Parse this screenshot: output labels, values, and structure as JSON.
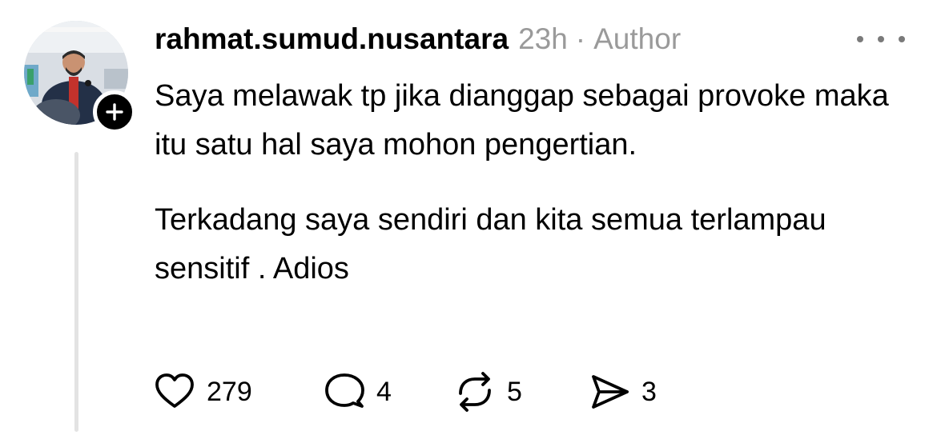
{
  "post": {
    "username": "rahmat.sumud.nusantara",
    "time": "23h",
    "separator": "·",
    "author_label": "Author",
    "paragraphs": [
      "Saya melawak tp jika dianggap sebagai provoke maka itu satu hal saya mohon pengertian.",
      "Terkadang saya sendiri dan kita semua terlampau sensitif . Adios"
    ]
  },
  "actions": {
    "likes": "279",
    "replies": "4",
    "reposts": "5",
    "shares": "3"
  },
  "icons": {
    "like": "heart-icon",
    "reply": "speech-bubble-icon",
    "repost": "repost-arrows-icon",
    "share": "send-icon",
    "follow": "plus-icon",
    "more": "more-horizontal-icon"
  },
  "colors": {
    "text": "#000000",
    "meta": "#9a9a9a",
    "thread_line": "#e3e3e3"
  }
}
